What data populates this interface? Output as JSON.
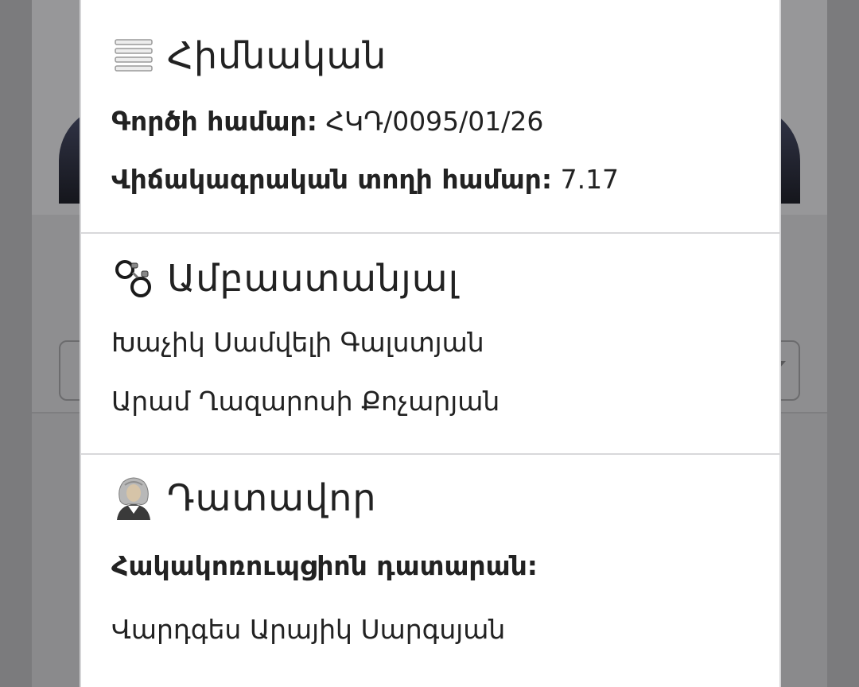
{
  "basic": {
    "title": "Հիմնական",
    "icon": "list-icon",
    "case_number_label": "Գործի համար:",
    "case_number_value": "ՀԿԴ/0095/01/26",
    "lottery_line_label": "Վիճակագրական տողի համար:",
    "lottery_line_value": "7.17"
  },
  "defendant": {
    "title": "Ամբաստանյալ",
    "icon": "handcuffs-icon",
    "names": [
      "Խաչիկ Սամվելի Գալստյան",
      "Արամ Ղազարոսի Քոչարյան"
    ]
  },
  "judge": {
    "title": "Դատավոր",
    "icon": "judge-icon",
    "court_label": "Հակակոռուպցիոն դատարան:",
    "judge_name": "Վարդգես Արայիկ Սարգսյան"
  }
}
